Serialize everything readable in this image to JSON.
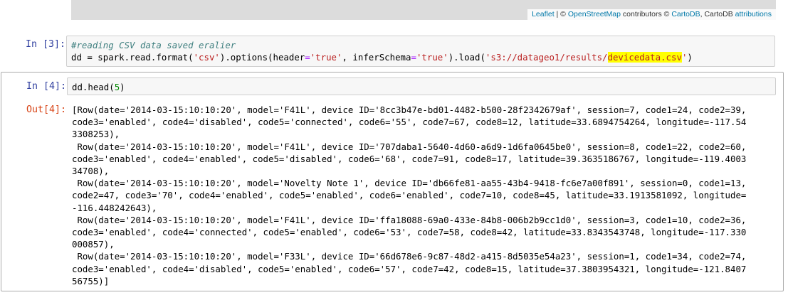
{
  "map": {
    "attribution_leaflet": "Leaflet",
    "attribution_sep": " | © ",
    "attribution_osm": "OpenStreetMap",
    "attribution_contrib": " contributors © ",
    "attribution_carto": "CartoDB",
    "attribution_carto2": ", CartoDB ",
    "attribution_attr": "attributions"
  },
  "cell3": {
    "prompt": "In [3]:",
    "comment": "#reading CSV data saved eralier",
    "code_prefix": "dd = spark.read.format(",
    "str_csv": "'csv'",
    "code_mid1": ").options(header",
    "eq1": "=",
    "str_true1": "'true'",
    "code_mid2": ", inferSchema",
    "eq2": "=",
    "str_true2": "'true'",
    "code_mid3": ").load(",
    "str_path_a": "'s3://datageo1/results/",
    "str_path_hl": "devicedata.csv",
    "str_path_b": "'",
    "code_end": ")"
  },
  "cell4": {
    "prompt": "In [4]:",
    "code_a": "dd.head(",
    "code_num": "5",
    "code_b": ")",
    "out_prompt": "Out[4]:",
    "output_lines": [
      "[Row(date='2014-03-15:10:10:20', model='F41L', device ID='8cc3b47e-bd01-4482-b500-28f2342679af', session=7, code1=24, code2=39,",
      "code3='enabled', code4='disabled', code5='connected', code6='55', code7=67, code8=12, latitude=33.6894754264, longitude=-117.54",
      "3308253),",
      " Row(date='2014-03-15:10:10:20', model='F41L', device ID='707daba1-5640-4d60-a6d9-1d6fa0645be0', session=8, code1=22, code2=60,",
      "code3='enabled', code4='enabled', code5='disabled', code6='68', code7=91, code8=17, latitude=39.3635186767, longitude=-119.4003",
      "34708),",
      " Row(date='2014-03-15:10:10:20', model='Novelty Note 1', device ID='db66fe81-aa55-43b4-9418-fc6e7a00f891', session=0, code1=13,",
      "code2=47, code3='70', code4='enabled', code5='enabled', code6='enabled', code7=10, code8=45, latitude=33.1913581092, longitude=",
      "-116.448242643),",
      " Row(date='2014-03-15:10:10:20', model='F41L', device ID='ffa18088-69a0-433e-84b8-006b2b9cc1d0', session=3, code1=10, code2=36,",
      "code3='enabled', code4='connected', code5='enabled', code6='53', code7=58, code8=42, latitude=33.8343543748, longitude=-117.330",
      "000857),",
      " Row(date='2014-03-15:10:10:20', model='F33L', device ID='66d678e6-9c87-48d2-a415-8d5035e54a23', session=1, code1=34, code2=74,",
      "code3='enabled', code4='disabled', code5='enabled', code6='57', code7=42, code8=15, latitude=37.3803954321, longitude=-121.8407",
      "56755)]"
    ]
  }
}
